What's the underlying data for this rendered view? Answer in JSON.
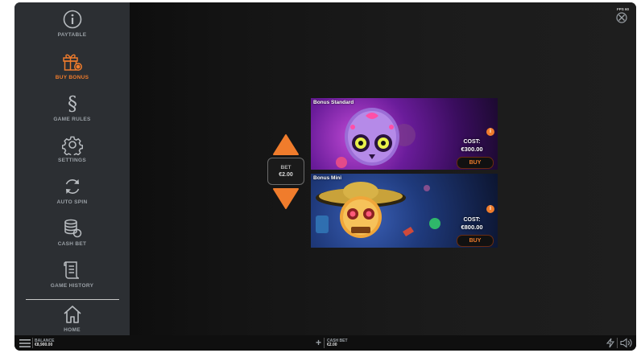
{
  "sidebar": {
    "items": [
      {
        "label": "PAYTABLE",
        "icon": "info-icon"
      },
      {
        "label": "BUY BONUS",
        "icon": "gift-icon",
        "active": true
      },
      {
        "label": "GAME RULES",
        "icon": "section-icon"
      },
      {
        "label": "SETTINGS",
        "icon": "gear-icon"
      },
      {
        "label": "AUTO SPIN",
        "icon": "refresh-icon"
      },
      {
        "label": "CASH BET",
        "icon": "coins-icon"
      },
      {
        "label": "GAME HISTORY",
        "icon": "scroll-icon"
      },
      {
        "label": "HOME",
        "icon": "home-icon"
      }
    ]
  },
  "bet": {
    "label": "BET",
    "value": "€2.00"
  },
  "bonuses": [
    {
      "title": "Bonus Standard",
      "cost_label": "COST:",
      "cost_value": "€300.00",
      "buy_label": "BUY",
      "info_glyph": "i"
    },
    {
      "title": "Bonus Mini",
      "cost_label": "COST:",
      "cost_value": "€800.00",
      "buy_label": "BUY",
      "info_glyph": "i"
    }
  ],
  "bottom_bar": {
    "balance_label": "BALANCE",
    "balance_value": "€8,900.00",
    "cash_bet_label": "CASH BET",
    "cash_bet_value": "€2.00",
    "plus_glyph": "+"
  },
  "top_right": {
    "fps": "FPS 60"
  },
  "colors": {
    "accent": "#f07c2c",
    "sidebar_bg": "#2c2f33",
    "frame_bg": "#141414"
  }
}
